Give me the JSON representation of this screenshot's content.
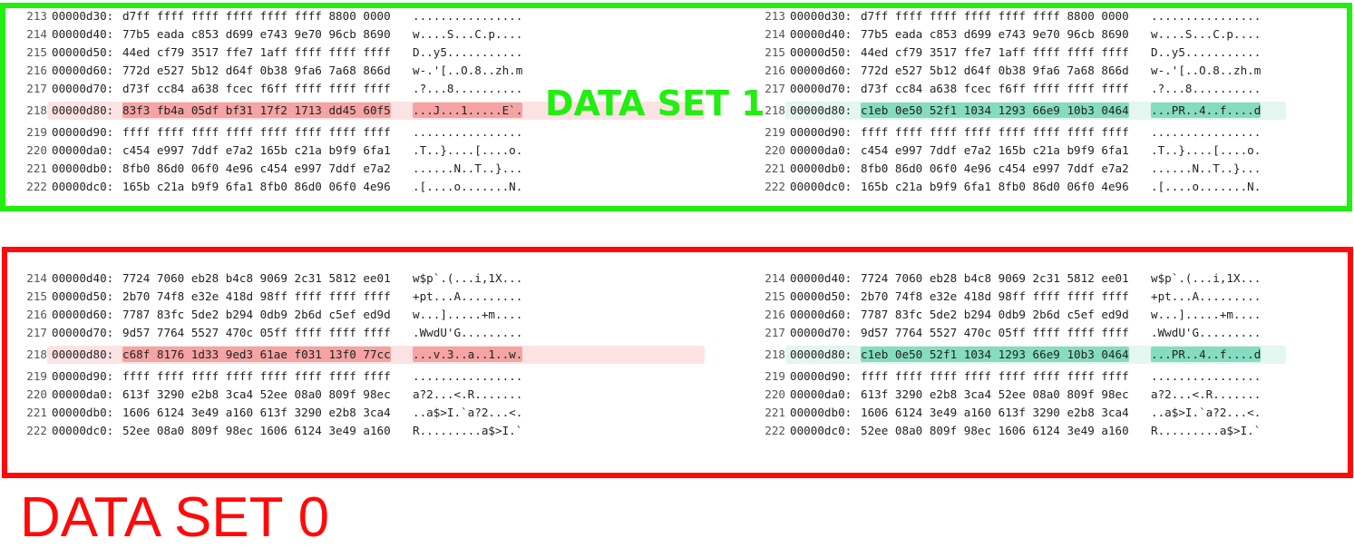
{
  "data_set_1": {
    "label": "DATA SET 1",
    "color": "#22ee11",
    "left": [
      {
        "ln": "213",
        "off": "00000d30:",
        "hex": "d7ff ffff ffff ffff ffff ffff 8800 0000",
        "asc": "................"
      },
      {
        "ln": "214",
        "off": "00000d40:",
        "hex": "77b5 eada c853 d699 e743 9e70 96cb 8690",
        "asc": "w....S...C.p...."
      },
      {
        "ln": "215",
        "off": "00000d50:",
        "hex": "44ed cf79 3517 ffe7 1aff ffff ffff ffff",
        "asc": "D..y5..........."
      },
      {
        "ln": "216",
        "off": "00000d60:",
        "hex": "772d e527 5b12 d64f 0b38 9fa6 7a68 866d",
        "asc": "w-.'[..O.8..zh.m"
      },
      {
        "ln": "217",
        "off": "00000d70:",
        "hex": "d73f cc84 a638 fcec f6ff ffff ffff ffff",
        "asc": ".?...8.........."
      },
      {
        "ln": "218",
        "off": "00000d80:",
        "hex": "83f3 fb4a 05df bf31 17f2 1713 dd45 60f5",
        "asc": "...J...1.....E`.",
        "diff": true
      },
      {
        "ln": "219",
        "off": "00000d90:",
        "hex": "ffff ffff ffff ffff ffff ffff ffff ffff",
        "asc": "................"
      },
      {
        "ln": "220",
        "off": "00000da0:",
        "hex": "c454 e997 7ddf e7a2 165b c21a b9f9 6fa1",
        "asc": ".T..}....[....o."
      },
      {
        "ln": "221",
        "off": "00000db0:",
        "hex": "8fb0 86d0 06f0 4e96 c454 e997 7ddf e7a2",
        "asc": "......N..T..}..."
      },
      {
        "ln": "222",
        "off": "00000dc0:",
        "hex": "165b c21a b9f9 6fa1 8fb0 86d0 06f0 4e96",
        "asc": ".[....o.......N."
      }
    ],
    "right": [
      {
        "ln": "213",
        "off": "00000d30:",
        "hex": "d7ff ffff ffff ffff ffff ffff 8800 0000",
        "asc": "................"
      },
      {
        "ln": "214",
        "off": "00000d40:",
        "hex": "77b5 eada c853 d699 e743 9e70 96cb 8690",
        "asc": "w....S...C.p...."
      },
      {
        "ln": "215",
        "off": "00000d50:",
        "hex": "44ed cf79 3517 ffe7 1aff ffff ffff ffff",
        "asc": "D..y5..........."
      },
      {
        "ln": "216",
        "off": "00000d60:",
        "hex": "772d e527 5b12 d64f 0b38 9fa6 7a68 866d",
        "asc": "w-.'[..O.8..zh.m"
      },
      {
        "ln": "217",
        "off": "00000d70:",
        "hex": "d73f cc84 a638 fcec f6ff ffff ffff ffff",
        "asc": ".?...8.........."
      },
      {
        "ln": "218",
        "off": "00000d80:",
        "hex": "c1eb 0e50 52f1 1034 1293 66e9 10b3 0464",
        "asc": "...PR..4..f....d",
        "diff": true
      },
      {
        "ln": "219",
        "off": "00000d90:",
        "hex": "ffff ffff ffff ffff ffff ffff ffff ffff",
        "asc": "................"
      },
      {
        "ln": "220",
        "off": "00000da0:",
        "hex": "c454 e997 7ddf e7a2 165b c21a b9f9 6fa1",
        "asc": ".T..}....[....o."
      },
      {
        "ln": "221",
        "off": "00000db0:",
        "hex": "8fb0 86d0 06f0 4e96 c454 e997 7ddf e7a2",
        "asc": "......N..T..}..."
      },
      {
        "ln": "222",
        "off": "00000dc0:",
        "hex": "165b c21a b9f9 6fa1 8fb0 86d0 06f0 4e96",
        "asc": ".[....o.......N."
      }
    ]
  },
  "data_set_0": {
    "label": "DATA SET 0",
    "color": "#ff0a0a",
    "left": [
      {
        "ln": "214",
        "off": "00000d40:",
        "hex": "7724 7060 eb28 b4c8 9069 2c31 5812 ee01",
        "asc": "w$p`.(...i,1X..."
      },
      {
        "ln": "215",
        "off": "00000d50:",
        "hex": "2b70 74f8 e32e 418d 98ff ffff ffff ffff",
        "asc": "+pt...A........."
      },
      {
        "ln": "216",
        "off": "00000d60:",
        "hex": "7787 83fc 5de2 b294 0db9 2b6d c5ef ed9d",
        "asc": "w...].....+m...."
      },
      {
        "ln": "217",
        "off": "00000d70:",
        "hex": "9d57 7764 5527 470c 05ff ffff ffff ffff",
        "asc": ".WwdU'G........."
      },
      {
        "ln": "218",
        "off": "00000d80:",
        "hex": "c68f 8176 1d33 9ed3 61ae f031 13f0 77cc",
        "asc": "...v.3..a..1..w.",
        "diff": true
      },
      {
        "ln": "219",
        "off": "00000d90:",
        "hex": "ffff ffff ffff ffff ffff ffff ffff ffff",
        "asc": "................"
      },
      {
        "ln": "220",
        "off": "00000da0:",
        "hex": "613f 3290 e2b8 3ca4 52ee 08a0 809f 98ec",
        "asc": "a?2...<.R......."
      },
      {
        "ln": "221",
        "off": "00000db0:",
        "hex": "1606 6124 3e49 a160 613f 3290 e2b8 3ca4",
        "asc": "..a$>I.`a?2...<."
      },
      {
        "ln": "222",
        "off": "00000dc0:",
        "hex": "52ee 08a0 809f 98ec 1606 6124 3e49 a160",
        "asc": "R.........a$>I.`"
      }
    ],
    "right": [
      {
        "ln": "214",
        "off": "00000d40:",
        "hex": "7724 7060 eb28 b4c8 9069 2c31 5812 ee01",
        "asc": "w$p`.(...i,1X..."
      },
      {
        "ln": "215",
        "off": "00000d50:",
        "hex": "2b70 74f8 e32e 418d 98ff ffff ffff ffff",
        "asc": "+pt...A........."
      },
      {
        "ln": "216",
        "off": "00000d60:",
        "hex": "7787 83fc 5de2 b294 0db9 2b6d c5ef ed9d",
        "asc": "w...].....+m...."
      },
      {
        "ln": "217",
        "off": "00000d70:",
        "hex": "9d57 7764 5527 470c 05ff ffff ffff ffff",
        "asc": ".WwdU'G........."
      },
      {
        "ln": "218",
        "off": "00000d80:",
        "hex": "c1eb 0e50 52f1 1034 1293 66e9 10b3 0464",
        "asc": "...PR..4..f....d",
        "diff": true
      },
      {
        "ln": "219",
        "off": "00000d90:",
        "hex": "ffff ffff ffff ffff ffff ffff ffff ffff",
        "asc": "................"
      },
      {
        "ln": "220",
        "off": "00000da0:",
        "hex": "613f 3290 e2b8 3ca4 52ee 08a0 809f 98ec",
        "asc": "a?2...<.R......."
      },
      {
        "ln": "221",
        "off": "00000db0:",
        "hex": "1606 6124 3e49 a160 613f 3290 e2b8 3ca4",
        "asc": "..a$>I.`a?2...<."
      },
      {
        "ln": "222",
        "off": "00000dc0:",
        "hex": "52ee 08a0 809f 98ec 1606 6124 3e49 a160",
        "asc": "R.........a$>I.`"
      }
    ]
  }
}
